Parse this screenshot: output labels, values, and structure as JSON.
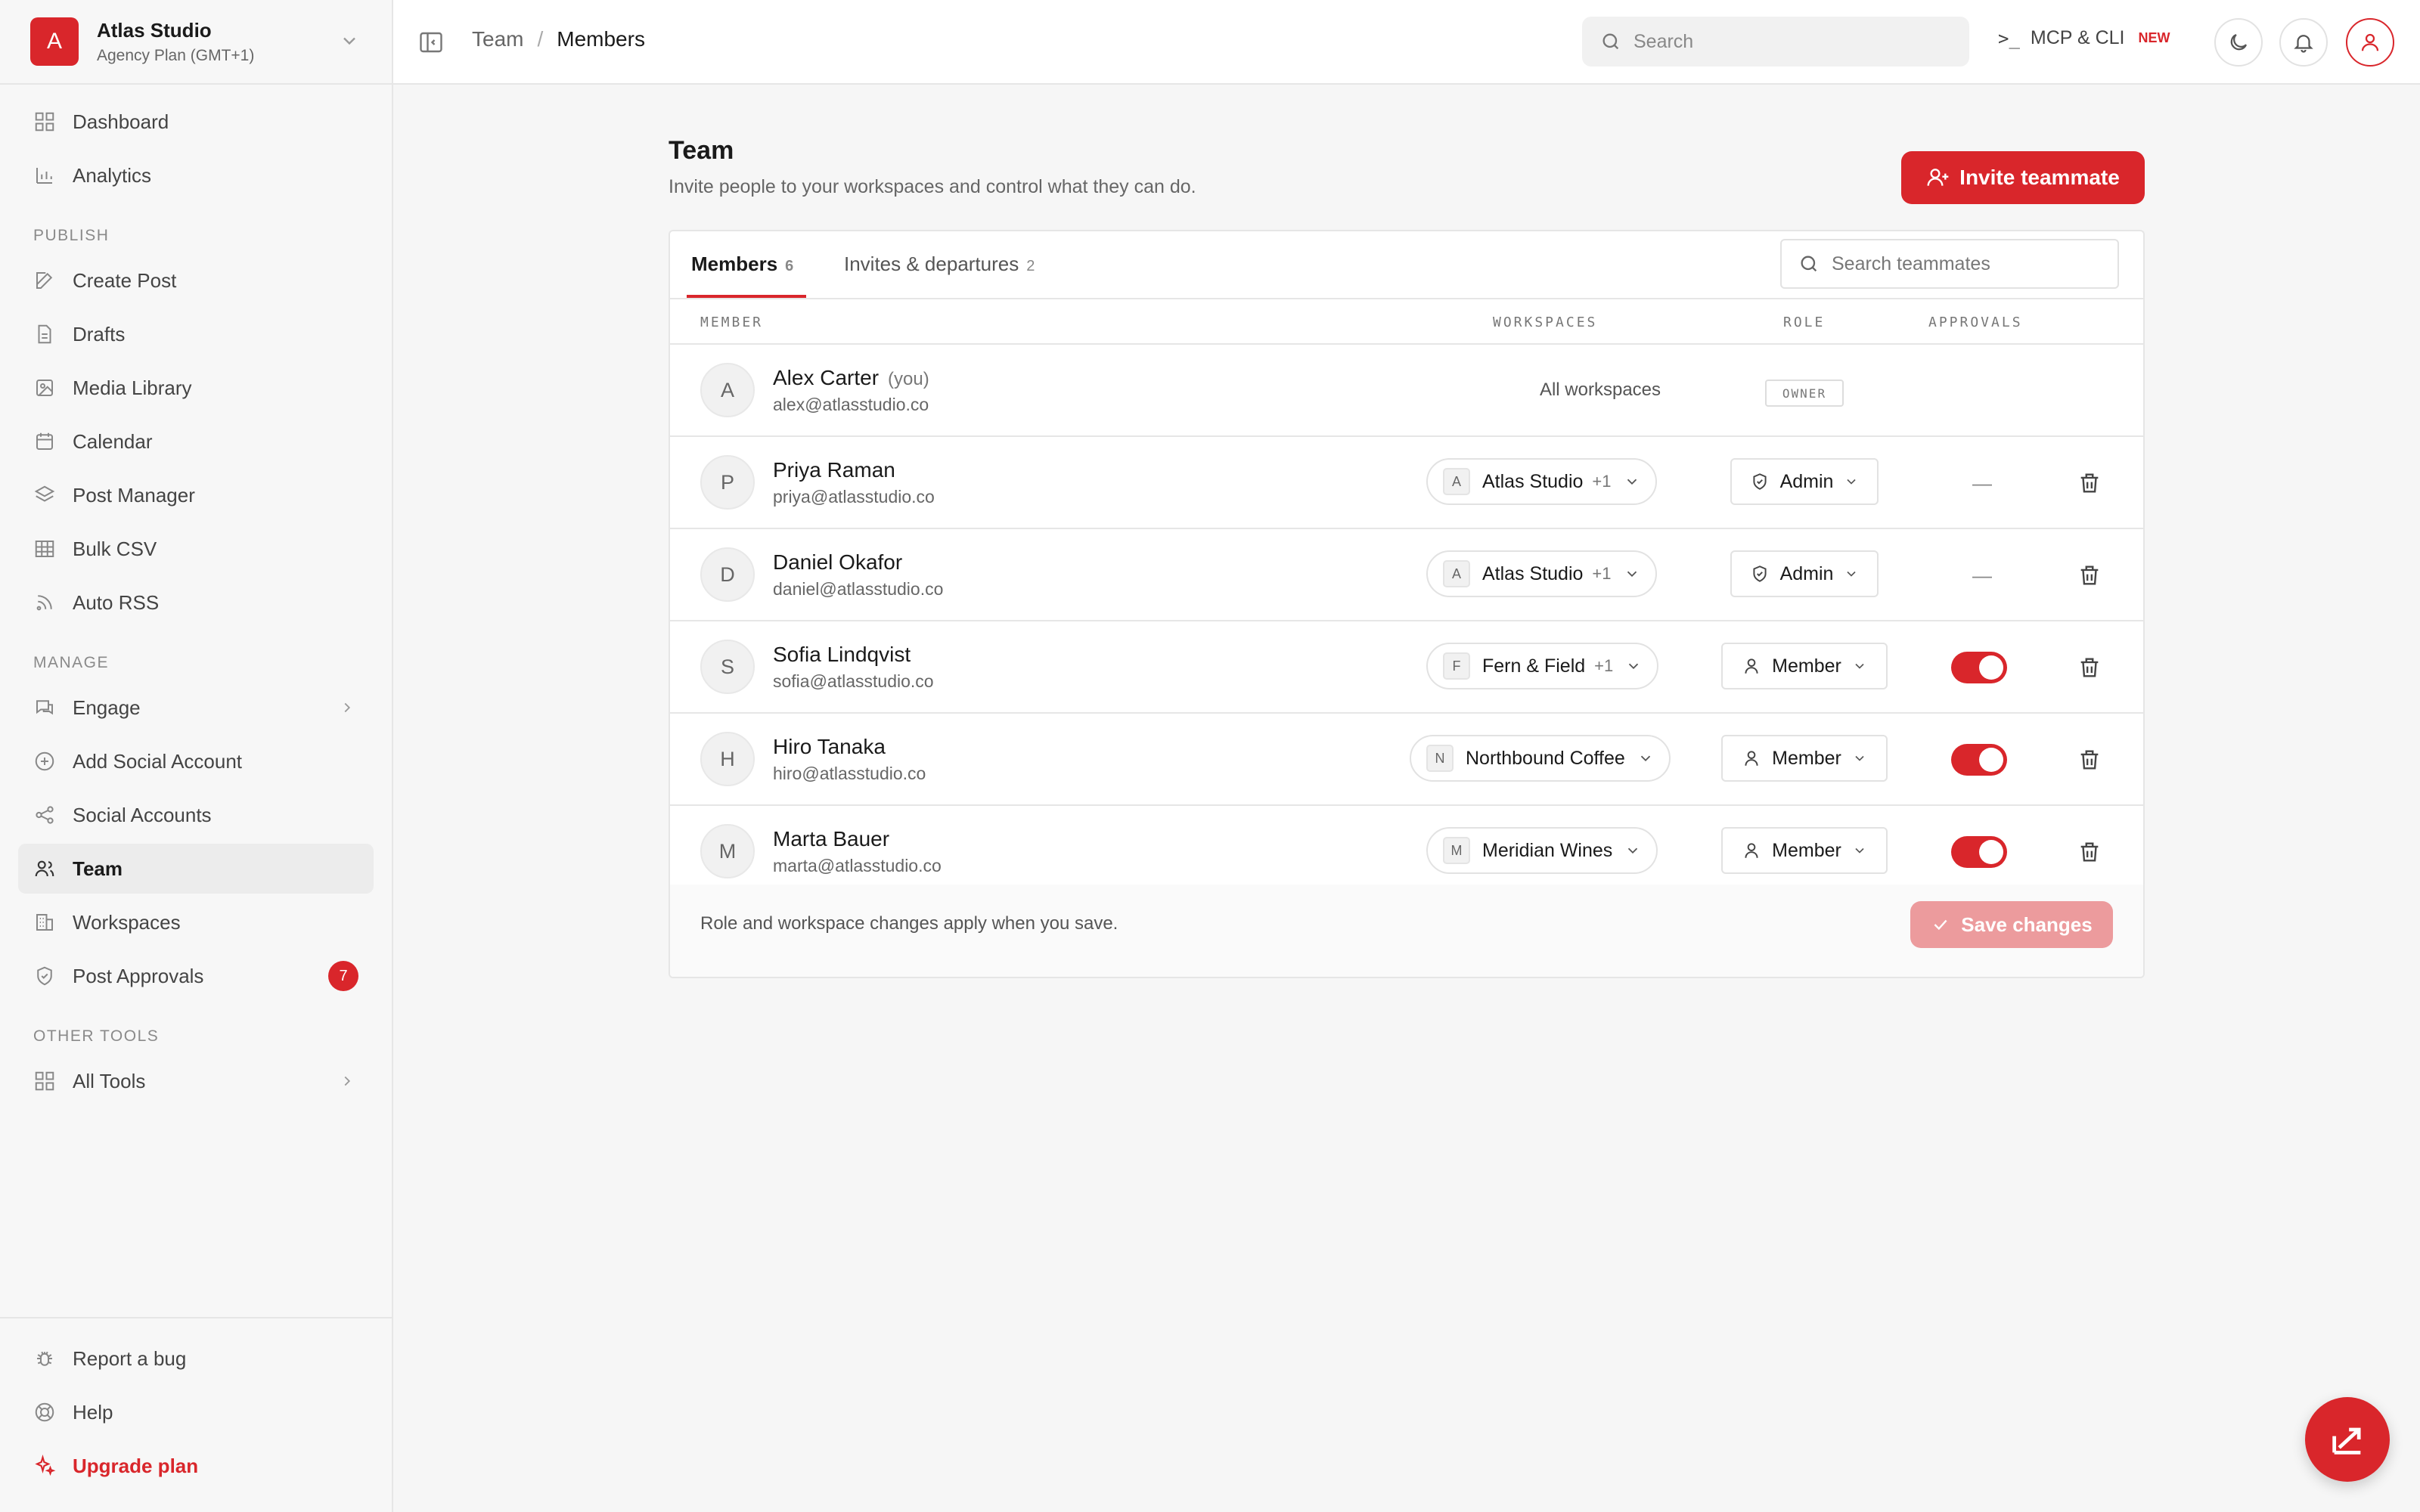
{
  "colors": {
    "accent": "#d9262b",
    "accent_disabled": "#ec9b9d"
  },
  "brand": {
    "logo_letter": "A",
    "name": "Atlas Studio",
    "plan": "Agency Plan (GMT+1)"
  },
  "sidebar": {
    "top_items": [
      {
        "label": "Dashboard",
        "icon": "grid-icon"
      },
      {
        "label": "Analytics",
        "icon": "bar-chart-icon"
      }
    ],
    "sections": {
      "publish": "PUBLISH",
      "manage": "MANAGE",
      "other": "OTHER TOOLS"
    },
    "publish_items": [
      {
        "label": "Create Post",
        "icon": "edit-icon"
      },
      {
        "label": "Drafts",
        "icon": "file-icon"
      },
      {
        "label": "Media Library",
        "icon": "image-icon"
      },
      {
        "label": "Calendar",
        "icon": "calendar-icon"
      },
      {
        "label": "Post Manager",
        "icon": "layers-icon"
      },
      {
        "label": "Bulk CSV",
        "icon": "table-icon"
      },
      {
        "label": "Auto RSS",
        "icon": "rss-icon"
      }
    ],
    "manage_items": [
      {
        "label": "Engage",
        "icon": "chat-icon"
      },
      {
        "label": "Add Social Account",
        "icon": "plus-circle-icon"
      },
      {
        "label": "Social Accounts",
        "icon": "share-icon"
      },
      {
        "label": "Team",
        "icon": "users-icon"
      },
      {
        "label": "Workspaces",
        "icon": "building-icon"
      },
      {
        "label": "Post Approvals",
        "icon": "shield-check-icon",
        "badge": "7"
      }
    ],
    "other_items": [
      {
        "label": "All Tools",
        "icon": "grid-icon"
      }
    ],
    "bottom_items": [
      {
        "label": "Report a bug",
        "icon": "bug-icon"
      },
      {
        "label": "Help",
        "icon": "lifebuoy-icon"
      },
      {
        "label": "Upgrade plan",
        "icon": "sparkle-icon"
      }
    ]
  },
  "topbar": {
    "breadcrumb_parent": "Team",
    "breadcrumb_sep": "/",
    "breadcrumb_current": "Members",
    "search_placeholder": "Search",
    "mcp_glyph": ">_",
    "mcp_label": "MCP & CLI",
    "mcp_badge": "NEW"
  },
  "page": {
    "title": "Team",
    "subtitle": "Invite people to your workspaces and control what they can do.",
    "invite_label": "Invite teammate"
  },
  "tabs": [
    {
      "label": "Members",
      "count": "6"
    },
    {
      "label": "Invites & departures",
      "count": "2"
    }
  ],
  "table_search_placeholder": "Search teammates",
  "columns": {
    "member": "MEMBER",
    "workspaces": "WORKSPACES",
    "role": "ROLE",
    "approvals": "APPROVALS"
  },
  "members": [
    {
      "initial": "A",
      "name": "Alex Carter",
      "you": "(you)",
      "email": "alex@atlasstudio.co",
      "workspaces_text": "All workspaces",
      "owner_tag": "OWNER"
    },
    {
      "initial": "P",
      "name": "Priya Raman",
      "email": "priya@atlasstudio.co",
      "ws_letter": "A",
      "ws_name": "Atlas Studio",
      "ws_extra": "+1",
      "role": "Admin",
      "approvals": "—"
    },
    {
      "initial": "D",
      "name": "Daniel Okafor",
      "email": "daniel@atlasstudio.co",
      "ws_letter": "A",
      "ws_name": "Atlas Studio",
      "ws_extra": "+1",
      "role": "Admin",
      "approvals": "—"
    },
    {
      "initial": "S",
      "name": "Sofia Lindqvist",
      "email": "sofia@atlasstudio.co",
      "ws_letter": "F",
      "ws_name": "Fern & Field",
      "ws_extra": "+1",
      "role": "Member",
      "approvals_on": true
    },
    {
      "initial": "H",
      "name": "Hiro Tanaka",
      "email": "hiro@atlasstudio.co",
      "ws_letter": "N",
      "ws_name": "Northbound Coffee",
      "role": "Member",
      "approvals_on": true
    },
    {
      "initial": "M",
      "name": "Marta Bauer",
      "email": "marta@atlasstudio.co",
      "ws_letter": "M",
      "ws_name": "Meridian Wines",
      "role": "Member",
      "approvals_on": true
    }
  ],
  "footer": {
    "note": "Role and workspace changes apply when you save.",
    "save_label": "Save changes"
  }
}
